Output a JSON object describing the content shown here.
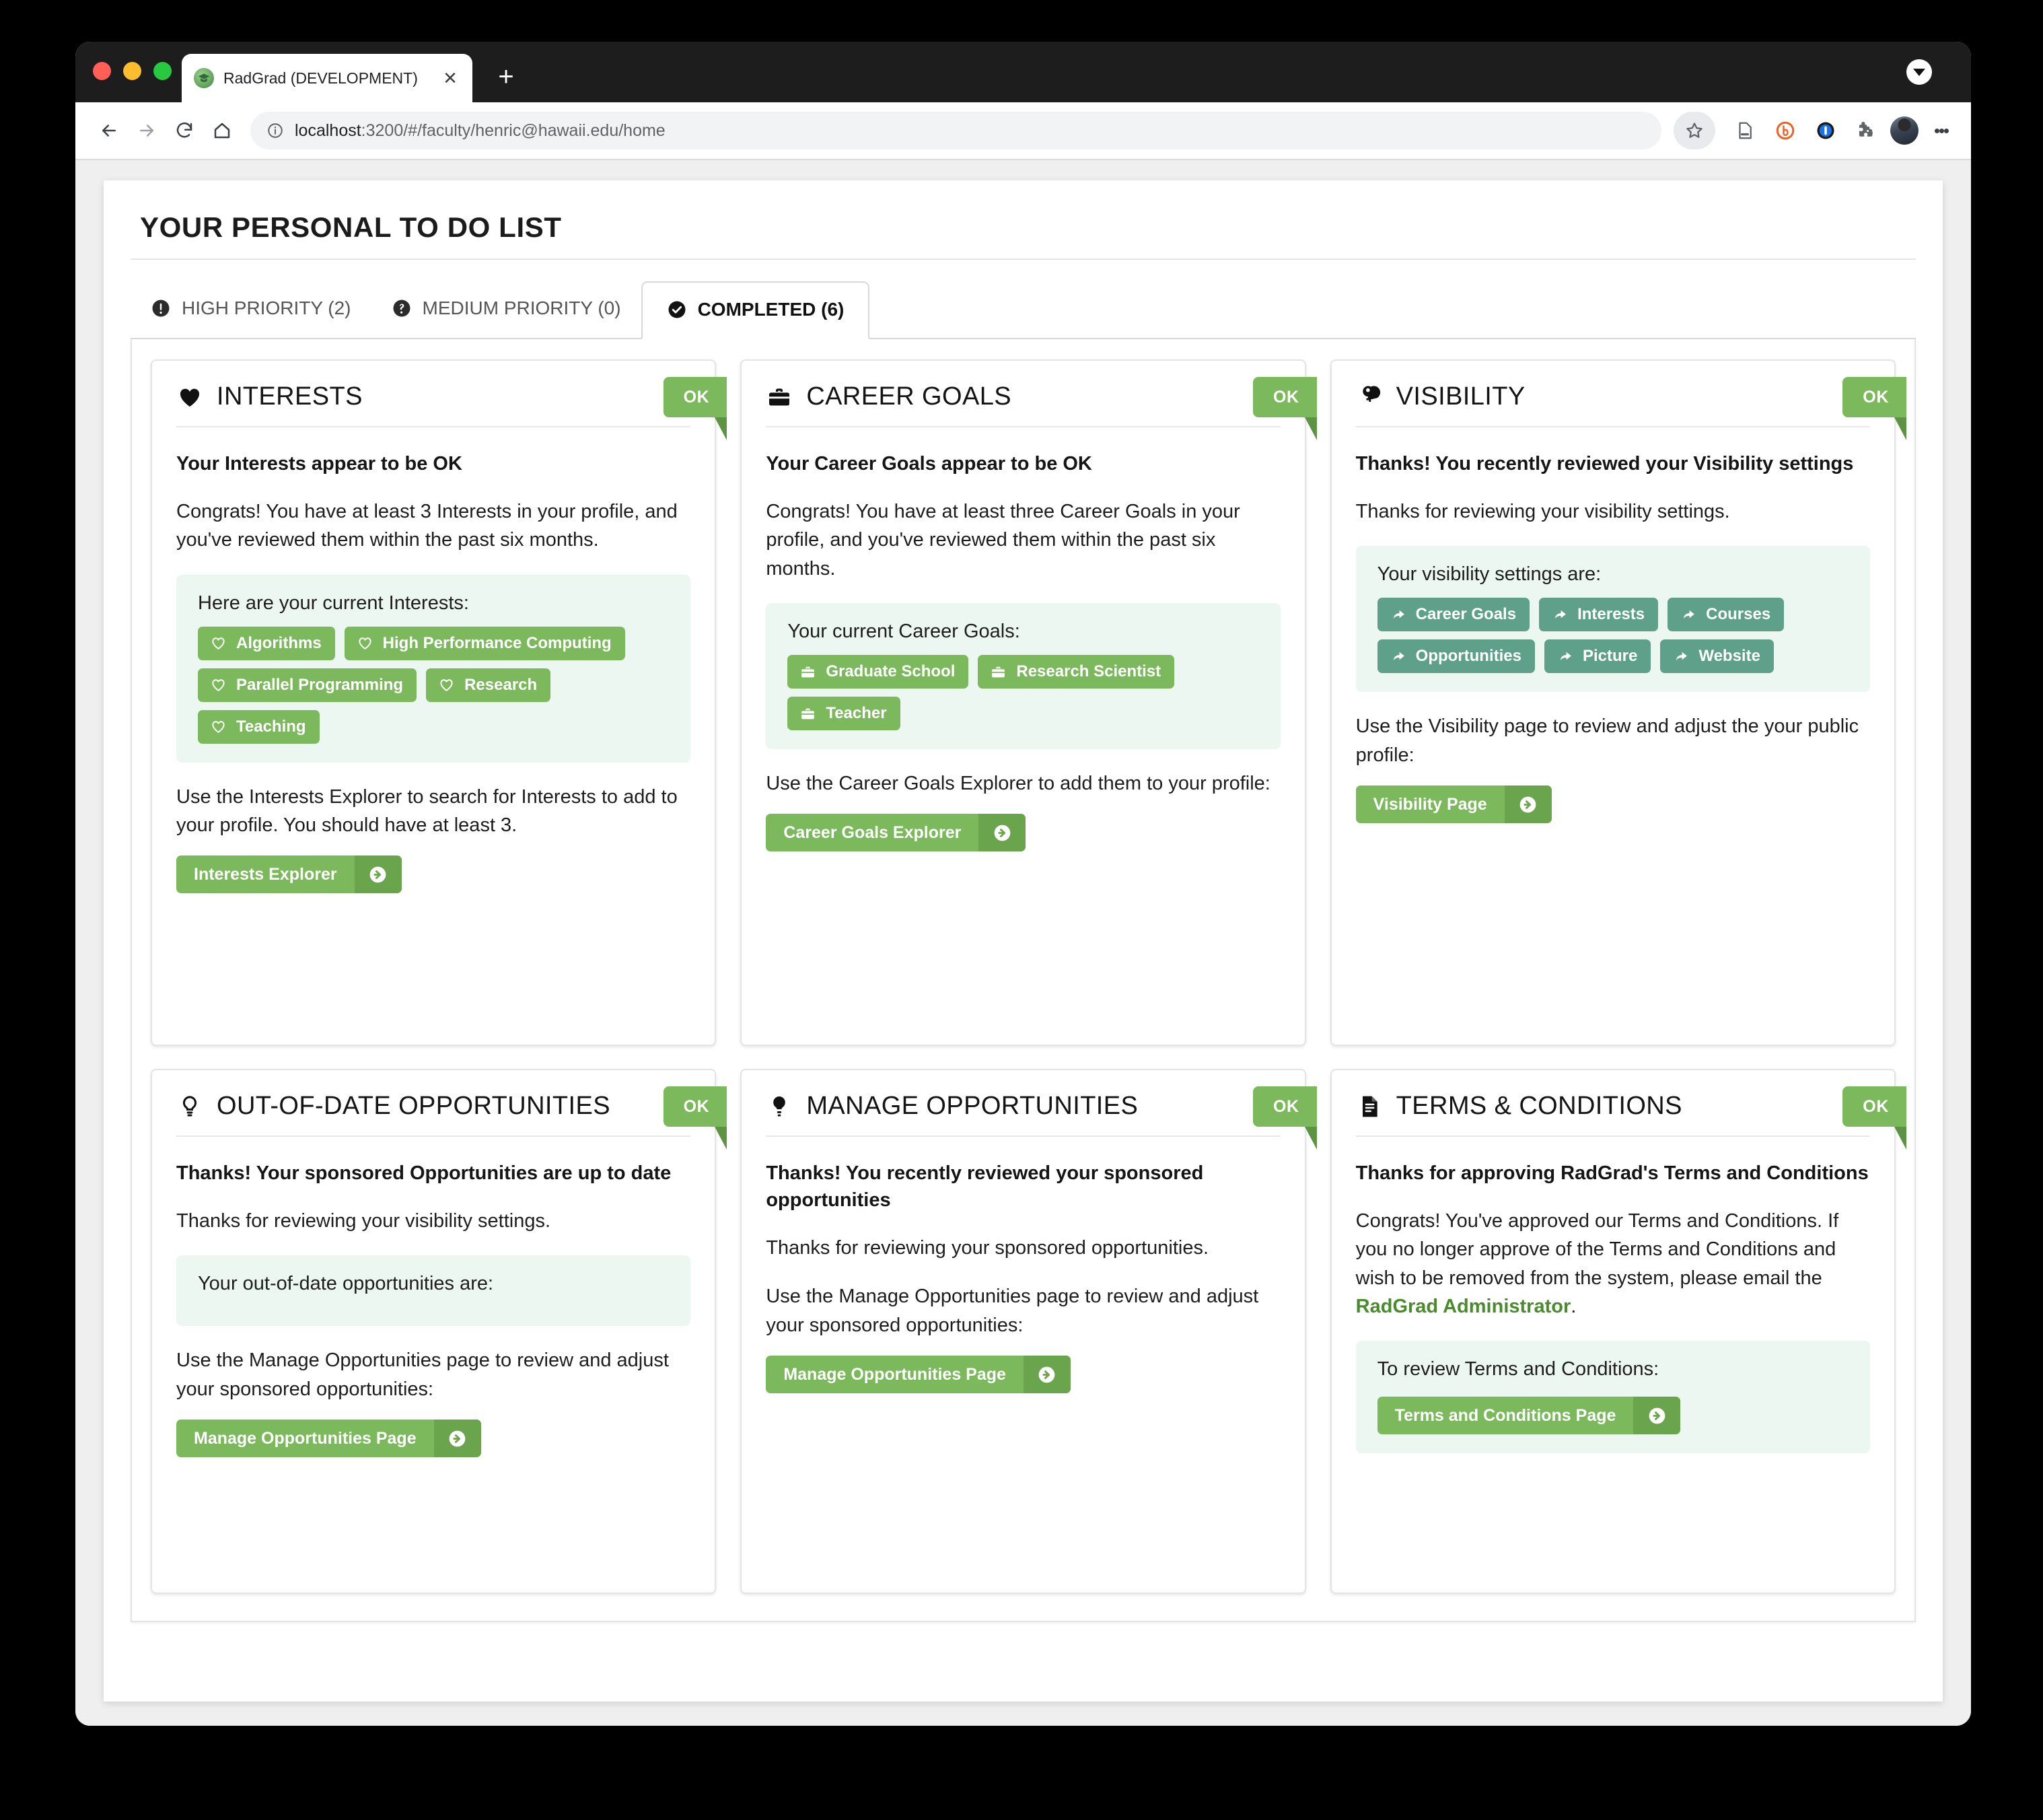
{
  "browser": {
    "tab_title": "RadGrad (DEVELOPMENT)",
    "tab_close_label": "✕",
    "new_tab_label": "+",
    "url_host": "localhost",
    "url_rest": ":3200/#/faculty/henric@hawaii.edu/home",
    "toolbar_icons": [
      "back-icon",
      "forward-icon",
      "reload-icon",
      "home-icon",
      "bookmark-star-icon",
      "reading-list-icon",
      "bitly-extension-icon",
      "onepassword-extension-icon",
      "extensions-puzzle-icon",
      "profile-avatar",
      "chrome-menu-icon"
    ]
  },
  "page": {
    "title": "YOUR PERSONAL TO DO LIST"
  },
  "tabs": [
    {
      "label": "HIGH PRIORITY (2)",
      "icon": "exclamation-circle-icon",
      "active": false
    },
    {
      "label": "MEDIUM PRIORITY (0)",
      "icon": "question-circle-icon",
      "active": false
    },
    {
      "label": "COMPLETED (6)",
      "icon": "check-circle-icon",
      "active": true
    }
  ],
  "colors": {
    "green": "#7cb85c",
    "green_dark": "#6aa44c",
    "green_fold": "#5d9444",
    "teal": "#5fa08b",
    "tint": "#edf7f2",
    "link_green": "#4a8b2c"
  },
  "cards": [
    {
      "icon": "heart-filled-icon",
      "title": "INTERESTS",
      "badge": "OK",
      "lead": "Your Interests appear to be OK",
      "body": "Congrats! You have at least 3 Interests in your profile, and you've reviewed them within the past six months.",
      "tint_label": "Here are your current Interests:",
      "chips": [
        {
          "label": "Algorithms",
          "icon": "heart-outline-icon"
        },
        {
          "label": "High Performance Computing",
          "icon": "heart-outline-icon"
        },
        {
          "label": "Parallel Programming",
          "icon": "heart-outline-icon"
        },
        {
          "label": "Research",
          "icon": "heart-outline-icon"
        },
        {
          "label": "Teaching",
          "icon": "heart-outline-icon"
        }
      ],
      "note": "Use the Interests Explorer to search for Interests to add to your profile. You should have at least 3.",
      "button": "Interests Explorer"
    },
    {
      "icon": "briefcase-icon",
      "title": "CAREER GOALS",
      "badge": "OK",
      "lead": "Your Career Goals appear to be OK",
      "body": "Congrats! You have at least three Career Goals in your profile, and you've reviewed them within the past six months.",
      "tint_label": "Your current Career Goals:",
      "chips": [
        {
          "label": "Graduate School",
          "icon": "briefcase-icon"
        },
        {
          "label": "Research Scientist",
          "icon": "briefcase-icon"
        },
        {
          "label": "Teacher",
          "icon": "briefcase-icon"
        }
      ],
      "note": "Use the Career Goals Explorer to add them to your profile:",
      "button": "Career Goals Explorer"
    },
    {
      "icon": "key-icon",
      "title": "VISIBILITY",
      "badge": "OK",
      "lead": "Thanks! You recently reviewed your Visibility settings",
      "body": "Thanks for reviewing your visibility settings.",
      "tint_label": "Your visibility settings are:",
      "chips": [
        {
          "label": "Career Goals",
          "icon": "share-arrow-icon"
        },
        {
          "label": "Interests",
          "icon": "share-arrow-icon"
        },
        {
          "label": "Courses",
          "icon": "share-arrow-icon"
        },
        {
          "label": "Opportunities",
          "icon": "share-arrow-icon"
        },
        {
          "label": "Picture",
          "icon": "share-arrow-icon"
        },
        {
          "label": "Website",
          "icon": "share-arrow-icon"
        }
      ],
      "note": "Use the Visibility page to review and adjust the your public profile:",
      "button": "Visibility Page"
    },
    {
      "icon": "lightbulb-outline-icon",
      "title": "OUT-OF-DATE OPPORTUNITIES",
      "badge": "OK",
      "lead": "Thanks! Your sponsored Opportunities are up to date",
      "body": "Thanks for reviewing your visibility settings.",
      "tint_label": "Your out-of-date opportunities are:",
      "chips": [],
      "note": "Use the Manage Opportunities page to review and adjust your sponsored opportunities:",
      "button": "Manage Opportunities Page"
    },
    {
      "icon": "lightbulb-filled-icon",
      "title": "MANAGE OPPORTUNITIES",
      "badge": "OK",
      "lead": "Thanks! You recently reviewed your sponsored opportunities",
      "body": "Thanks for reviewing your sponsored opportunities.",
      "note": "Use the Manage Opportunities page to review and adjust your sponsored opportunities:",
      "button": "Manage Opportunities Page"
    },
    {
      "icon": "document-icon",
      "title": "TERMS & CONDITIONS",
      "badge": "OK",
      "lead": "Thanks for approving RadGrad's Terms and Conditions",
      "body_pre": "Congrats! You've approved our Terms and Conditions. If you no longer approve of the Terms and Conditions and wish to be removed from the system, please email the ",
      "body_link": "RadGrad Administrator",
      "body_post": ".",
      "tint_label": "To review Terms and Conditions:",
      "button": "Terms and Conditions Page"
    }
  ]
}
